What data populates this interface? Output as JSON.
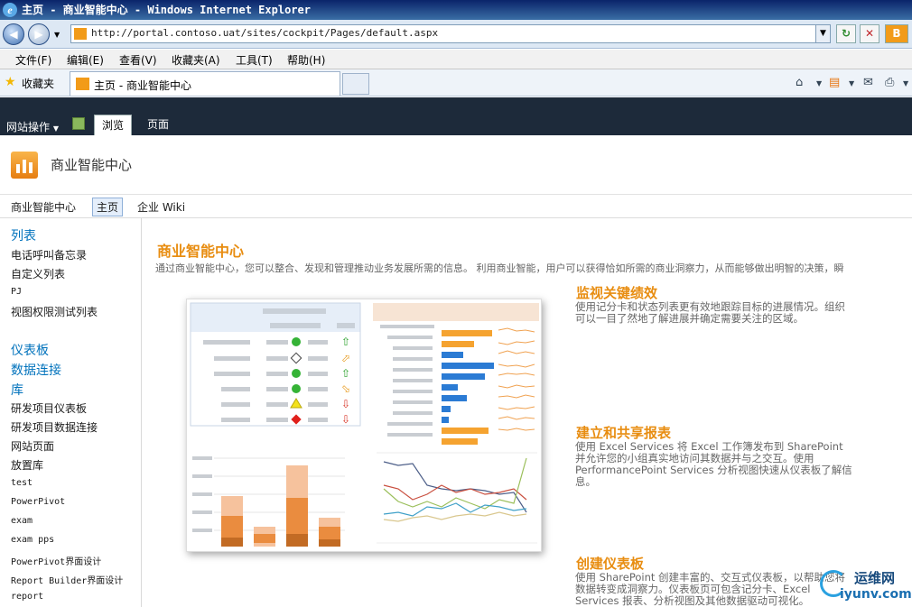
{
  "browser": {
    "window_title": "主页 - 商业智能中心 - Windows Internet Explorer",
    "url": "http://portal.contoso.uat/sites/cockpit/Pages/default.aspx",
    "menu": [
      "文件(F)",
      "编辑(E)",
      "查看(V)",
      "收藏夹(A)",
      "工具(T)",
      "帮助(H)"
    ],
    "favorites_label": "收藏夹",
    "tab_title": "主页 - 商业智能中心",
    "right_partial": "B"
  },
  "sharepoint": {
    "site_actions": "网站操作",
    "ribbon_tabs": [
      "浏览",
      "页面"
    ],
    "site_title": "商业智能中心",
    "top_nav": [
      "商业智能中心",
      "主页",
      "企业 Wiki"
    ]
  },
  "quick_launch": {
    "lists_heading": "列表",
    "lists": [
      "电话呼叫备忘录",
      "自定义列表",
      "PJ",
      "视图权限测试列表"
    ],
    "headings": [
      "仪表板",
      "数据连接",
      "库"
    ],
    "libraries": [
      "研发项目仪表板",
      "研发项目数据连接",
      "网站页面",
      "放置库",
      "test",
      "PowerPivot",
      "exam",
      "exam pps",
      "PowerPivot界面设计",
      "Report Builder界面设计",
      "report"
    ]
  },
  "main": {
    "title": "商业智能中心",
    "description": "通过商业智能中心，您可以整合、发现和管理推动业务发展所需的信息。 利用商业智能，用户可以获得恰如所需的商业洞察力，从而能够做出明智的决策，瞬",
    "features": [
      {
        "title": "监视关键绩效",
        "text": "使用记分卡和状态列表更有效地跟踪目标的进展情况。组织可以一目了然地了解进展并确定需要关注的区域。"
      },
      {
        "title": "建立和共享报表",
        "text": "使用 Excel Services 将 Excel 工作簿发布到 SharePoint 并允许您的小组真实地访问其数据并与之交互。使用 PerformancePoint Services 分析视图快速从仪表板了解信息。"
      },
      {
        "title": "创建仪表板",
        "text": "使用 SharePoint 创建丰富的、交互式仪表板，以帮助您将数据转变成洞察力。仪表板页可包含记分卡、Excel Services 报表、分析视图及其他数据驱动可视化。"
      }
    ]
  },
  "watermark": {
    "name": "运维网",
    "domain": "iyunv.com"
  }
}
